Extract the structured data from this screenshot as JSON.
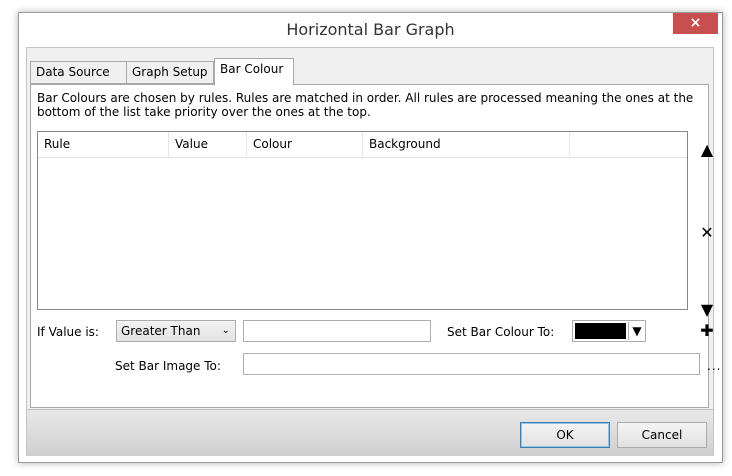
{
  "window": {
    "title": "Horizontal Bar Graph",
    "close_label": "×"
  },
  "tabs": [
    {
      "label": "Data Source",
      "active": false
    },
    {
      "label": "Graph Setup",
      "active": false
    },
    {
      "label": "Bar Colour",
      "active": true
    }
  ],
  "panel": {
    "description": "Bar Colours are chosen by rules. Rules are matched in order. All rules are processed meaning the ones at the bottom of the list take priority over the ones at the top.",
    "table": {
      "columns": [
        "Rule",
        "Value",
        "Colour",
        "Background"
      ],
      "rows": []
    },
    "side_buttons": {
      "move_up": "▲",
      "delete": "✕",
      "move_down": "▼",
      "add": "✚"
    },
    "if_value_label": "If Value is:",
    "condition": {
      "selected": "Greater Than",
      "chevron": "⌄"
    },
    "value_input": "",
    "set_colour_label": "Set Bar Colour To:",
    "colour": {
      "value": "#000000",
      "arrow": "▼"
    },
    "set_image_label": "Set Bar Image To:",
    "image_input": "",
    "browse_label": "..."
  },
  "footer": {
    "ok_label": "OK",
    "cancel_label": "Cancel"
  },
  "colors": {
    "close_button": "#c74f4f",
    "swatch": "#000000"
  }
}
